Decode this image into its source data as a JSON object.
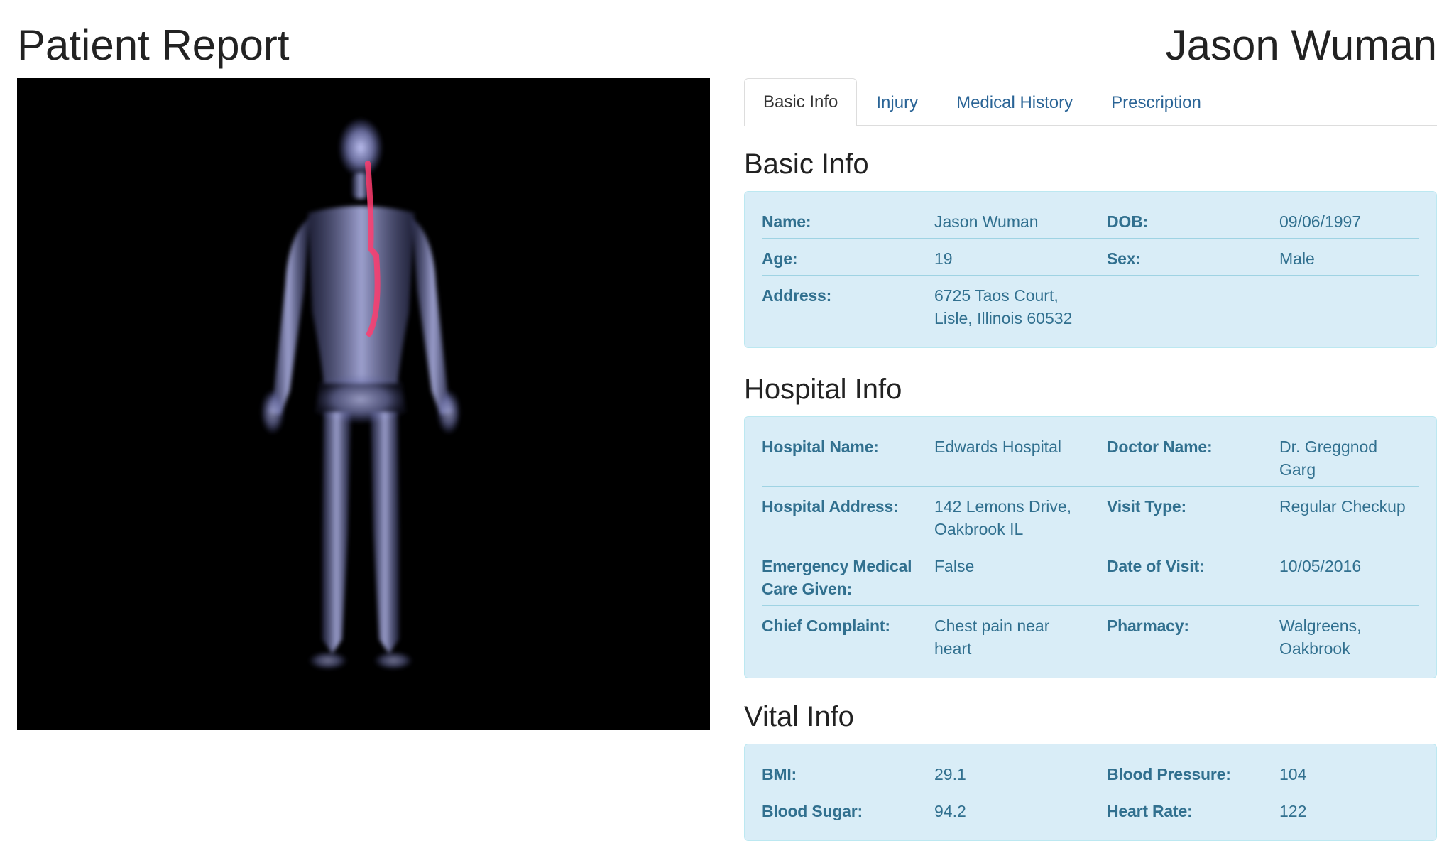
{
  "header": {
    "title": "Patient Report",
    "patient_name": "Jason Wuman"
  },
  "tabs": [
    {
      "label": "Basic Info",
      "active": true
    },
    {
      "label": "Injury",
      "active": false
    },
    {
      "label": "Medical History",
      "active": false
    },
    {
      "label": "Prescription",
      "active": false
    }
  ],
  "basic_info": {
    "title": "Basic Info",
    "rows": [
      {
        "l1": "Name:",
        "v1": "Jason Wuman",
        "l2": "DOB:",
        "v2": "09/06/1997"
      },
      {
        "l1": "Age:",
        "v1": "19",
        "l2": "Sex:",
        "v2": "Male"
      },
      {
        "l1": "Address:",
        "v1": "6725 Taos Court,\nLisle, Illinois 60532",
        "l2": "",
        "v2": ""
      }
    ]
  },
  "hospital_info": {
    "title": "Hospital Info",
    "rows": [
      {
        "l1": "Hospital Name:",
        "v1": "Edwards Hospital",
        "l2": "Doctor Name:",
        "v2": "Dr. Greggnod Garg"
      },
      {
        "l1": "Hospital Address:",
        "v1": "142 Lemons Drive,\nOakbrook IL",
        "l2": "Visit Type:",
        "v2": "Regular Checkup"
      },
      {
        "l1": "Emergency Medical\nCare Given:",
        "v1": "False",
        "l2": "Date of Visit:",
        "v2": "10/05/2016"
      },
      {
        "l1": "Chief Complaint:",
        "v1": "Chest pain near\nheart",
        "l2": "Pharmacy:",
        "v2": "Walgreens,\nOakbrook"
      }
    ]
  },
  "vital_info": {
    "title": "Vital Info",
    "rows": [
      {
        "l1": "BMI:",
        "v1": "29.1",
        "l2": "Blood Pressure:",
        "v2": "104"
      },
      {
        "l1": "Blood Sugar:",
        "v1": "94.2",
        "l2": "Heart Rate:",
        "v2": "122"
      }
    ]
  },
  "colors": {
    "tab_link": "#2a6496",
    "info_bg": "#d9edf7",
    "info_text": "#31708f",
    "highlight": "#ff3c6e"
  }
}
